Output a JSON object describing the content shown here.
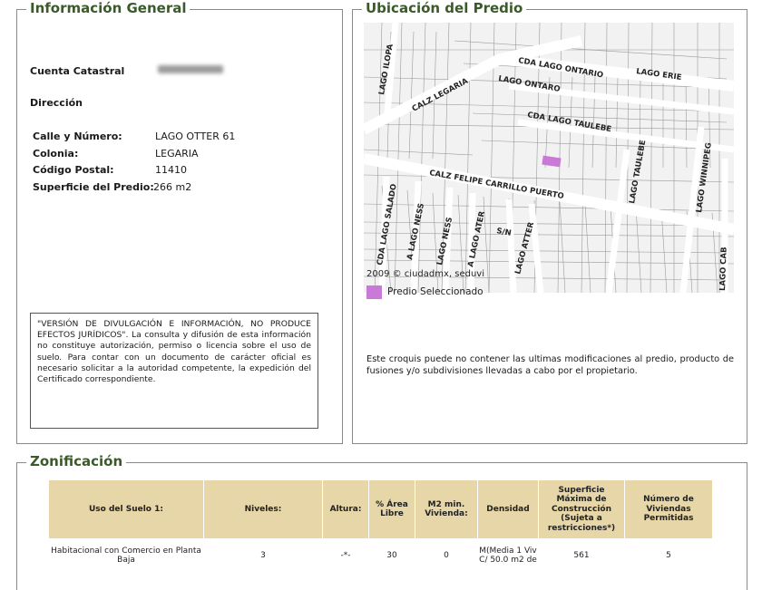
{
  "info": {
    "legend": "Información General",
    "cuenta_label": "Cuenta Catastral",
    "direccion_label": "Dirección",
    "calle_label": "Calle y Número:",
    "calle_value": "LAGO OTTER 61",
    "colonia_label": "Colonia:",
    "colonia_value": "LEGARIA",
    "cp_label": "Código Postal:",
    "cp_value": "11410",
    "superficie_label": "Superficie del Predio:",
    "superficie_value": "266 m2",
    "disclaimer": "\"VERSIÓN DE DIVULGACIÓN E INFORMACIÓN, NO PRODUCE EFECTOS JURÍDICOS\". La consulta y difusión de esta información no constituye autorización, permiso o licencia sobre el uso de suelo. Para contar con un documento de carácter oficial es necesario solicitar a la autoridad competente, la expedición del Certificado correspondiente."
  },
  "ubicacion": {
    "legend": "Ubicación del Predio",
    "streets": {
      "lago_ilopa": "LAGO ILOPA",
      "cda_lago_ontario": "CDA LAGO ONTARIO",
      "lago_erie": "LAGO ERIE",
      "calz_legaria": "CALZ LEGARIA",
      "lago_ontaro": "LAGO ONTARO",
      "cda_lago_taulebe": "CDA LAGO TAULEBE",
      "lago_taulebe": "LAGO TAULEBE",
      "lago_winnipeg": "LAGO WINNIPEG",
      "calz_felipe": "CALZ FELIPE CARRILLO PUERTO",
      "cda_lago_salado": "CDA LAGO SALADO",
      "lago_ness_1": "A LAGO NESS",
      "lago_ness_2": "LAGO NESS",
      "lago_ater": "A LAGO ATER",
      "sn": "S/N",
      "lago_atter": "LAGO ATTER",
      "lago_cab": "LAGO CAB"
    },
    "copyright": "2009 © ciudadmx, seduvi",
    "map_legend": "Predio Seleccionado",
    "highlight_color": "#c979d6",
    "note": "Este croquis puede no contener las ultimas modificaciones al predio, producto de fusiones y/o subdivisiones llevadas a cabo por el propietario."
  },
  "zonificacion": {
    "legend": "Zonificación",
    "header_color": "#e6d6a8",
    "headers": [
      "Uso del Suelo 1:",
      "Niveles:",
      "Altura:",
      "% Área Libre",
      "M2 min. Vivienda:",
      "Densidad",
      "Superficie Máxima de Construcción (Sujeta a restricciones*)",
      "Número de Viviendas Permitidas"
    ],
    "row": [
      "Habitacional con Comercio en Planta Baja",
      "3",
      "-*-",
      "30",
      "0",
      "M(Media 1 Viv C/ 50.0 m2 de",
      "561",
      "5"
    ]
  }
}
